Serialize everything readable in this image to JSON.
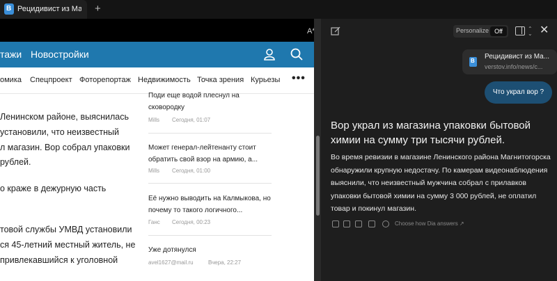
{
  "tab": {
    "title": "Рецидивист из Магни",
    "new_tab": "+"
  },
  "site": {
    "nav": [
      "тажи",
      "Новостройки"
    ],
    "subnav": [
      "омика",
      "Спецпроект",
      "Фоторепортаж",
      "Недвижимость",
      "Точка зрения",
      "Курьезы"
    ],
    "more": "•••"
  },
  "article": {
    "lines": [
      "Ленинском районе, выяснилась",
      "установили, что неизвестный",
      "л магазин. Вор собрал упаковки",
      "рублей.",
      "о краже в дежурную часть",
      "товой службы УМВД установили",
      "ся 45-летний местный житель, не",
      "привлекавшийся к уголовной"
    ]
  },
  "news": [
    {
      "title": "Поди еще водой плеснул на сковородку",
      "author": "Mills",
      "time": "Сегодня, 01:07"
    },
    {
      "title": "Может генерал-лейтенанту стоит обратить свой взор на армию, а...",
      "author": "Mills",
      "time": "Сегодня, 01:00"
    },
    {
      "title": "Её нужно выводить на Калмыкова, но почему то такого логичного...",
      "author": "Ганс",
      "time": "Сегодня, 00:23"
    },
    {
      "title": "Уже дотянулся",
      "author": "avel1627@mail.ru",
      "time": "Вчера, 22:27"
    }
  ],
  "sidebar": {
    "personalize_label": "Personalize",
    "personalize_state": "Off",
    "source": {
      "title": "Рецидивист из Ма...",
      "url": "verstov.info/news/c..."
    },
    "user_message": "Что украл вор ?",
    "answer_title": "Вор украл из магазина упаковки бытовой химии на сумму три тысячи рублей.",
    "answer_body": "Во время ревизии в магазине Ленинского района Магнитогорска обнаружили крупную недостачу. По камерам видеонаблюдения выяснили, что неизвестный мужчина собрал с прилавков упаковки бытовой химии на сумму 3 000 рублей, не оплатил товар и покинул магазин.",
    "choose_label": "Choose how Dia answers ↗"
  },
  "colors": {
    "site_header": "#1f78ae",
    "user_bubble": "#1d4f73",
    "sidebar_bg": "#1e1e1e"
  }
}
